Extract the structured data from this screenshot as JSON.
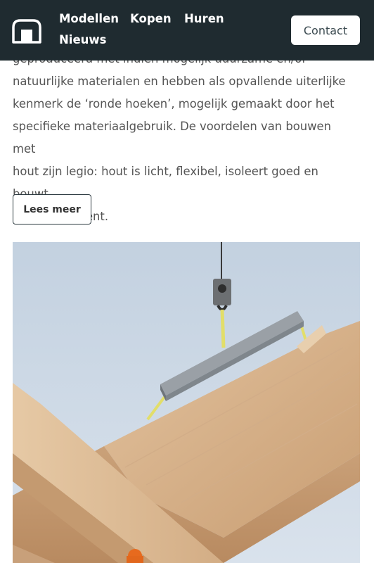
{
  "nav": {
    "logo_icon": "house-outline-icon",
    "links": [
      "Modellen",
      "Kopen",
      "Huren",
      "Nieuws"
    ],
    "contact_label": "Contact"
  },
  "article": {
    "partial_line": "geproduceerd met indien mogelijk duurzame en/of",
    "lines": [
      "natuurlijke materialen en hebben als opvallende uiterlijke",
      "kenmerk de ‘ronde hoeken’, mogelijk gemaakt door het",
      "specifieke materiaalgebruik. De voordelen van bouwen met",
      "hout zijn legio: hout is licht, flexibel, isoleert goed en bouwt",
      "snel en efficiënt."
    ],
    "read_more_label": "Lees meer"
  },
  "colors": {
    "navbar": "#1f2b30",
    "text": "#555555",
    "sky": "#c9d6e4",
    "wood": "#dcb894"
  }
}
